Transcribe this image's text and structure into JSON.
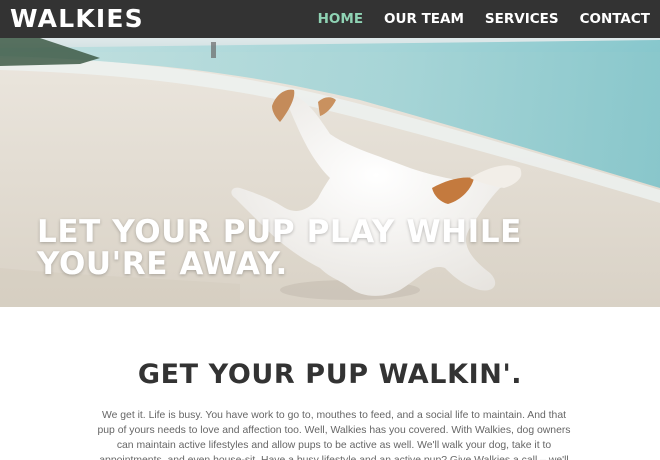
{
  "brand": "WALKIES",
  "nav": {
    "items": [
      {
        "label": "HOME"
      },
      {
        "label": "OUR TEAM"
      },
      {
        "label": "SERVICES"
      },
      {
        "label": "CONTACT"
      }
    ]
  },
  "hero": {
    "headline": "LET YOUR PUP PLAY WHILE YOU'RE AWAY."
  },
  "about": {
    "title": "GET YOUR PUP WALKIN'.",
    "text": "We get it. Life is busy. You have work to go to, mouthes to feed, and a social life to maintain. And that pup of yours needs to love and affection too. Well, Walkies has you covered. With Walkies, dog owners can maintain active lifestyles and allow pups to be active as well. We'll walk your dog, take it to appointments, and even house-sit. Have a busy lifestyle and an active pup? Give Walkies a call – we'll make it work!"
  },
  "colors": {
    "nav_bg": "#333333",
    "nav_active": "#8fd3b4",
    "heading": "#333333",
    "body_text": "#666666"
  }
}
